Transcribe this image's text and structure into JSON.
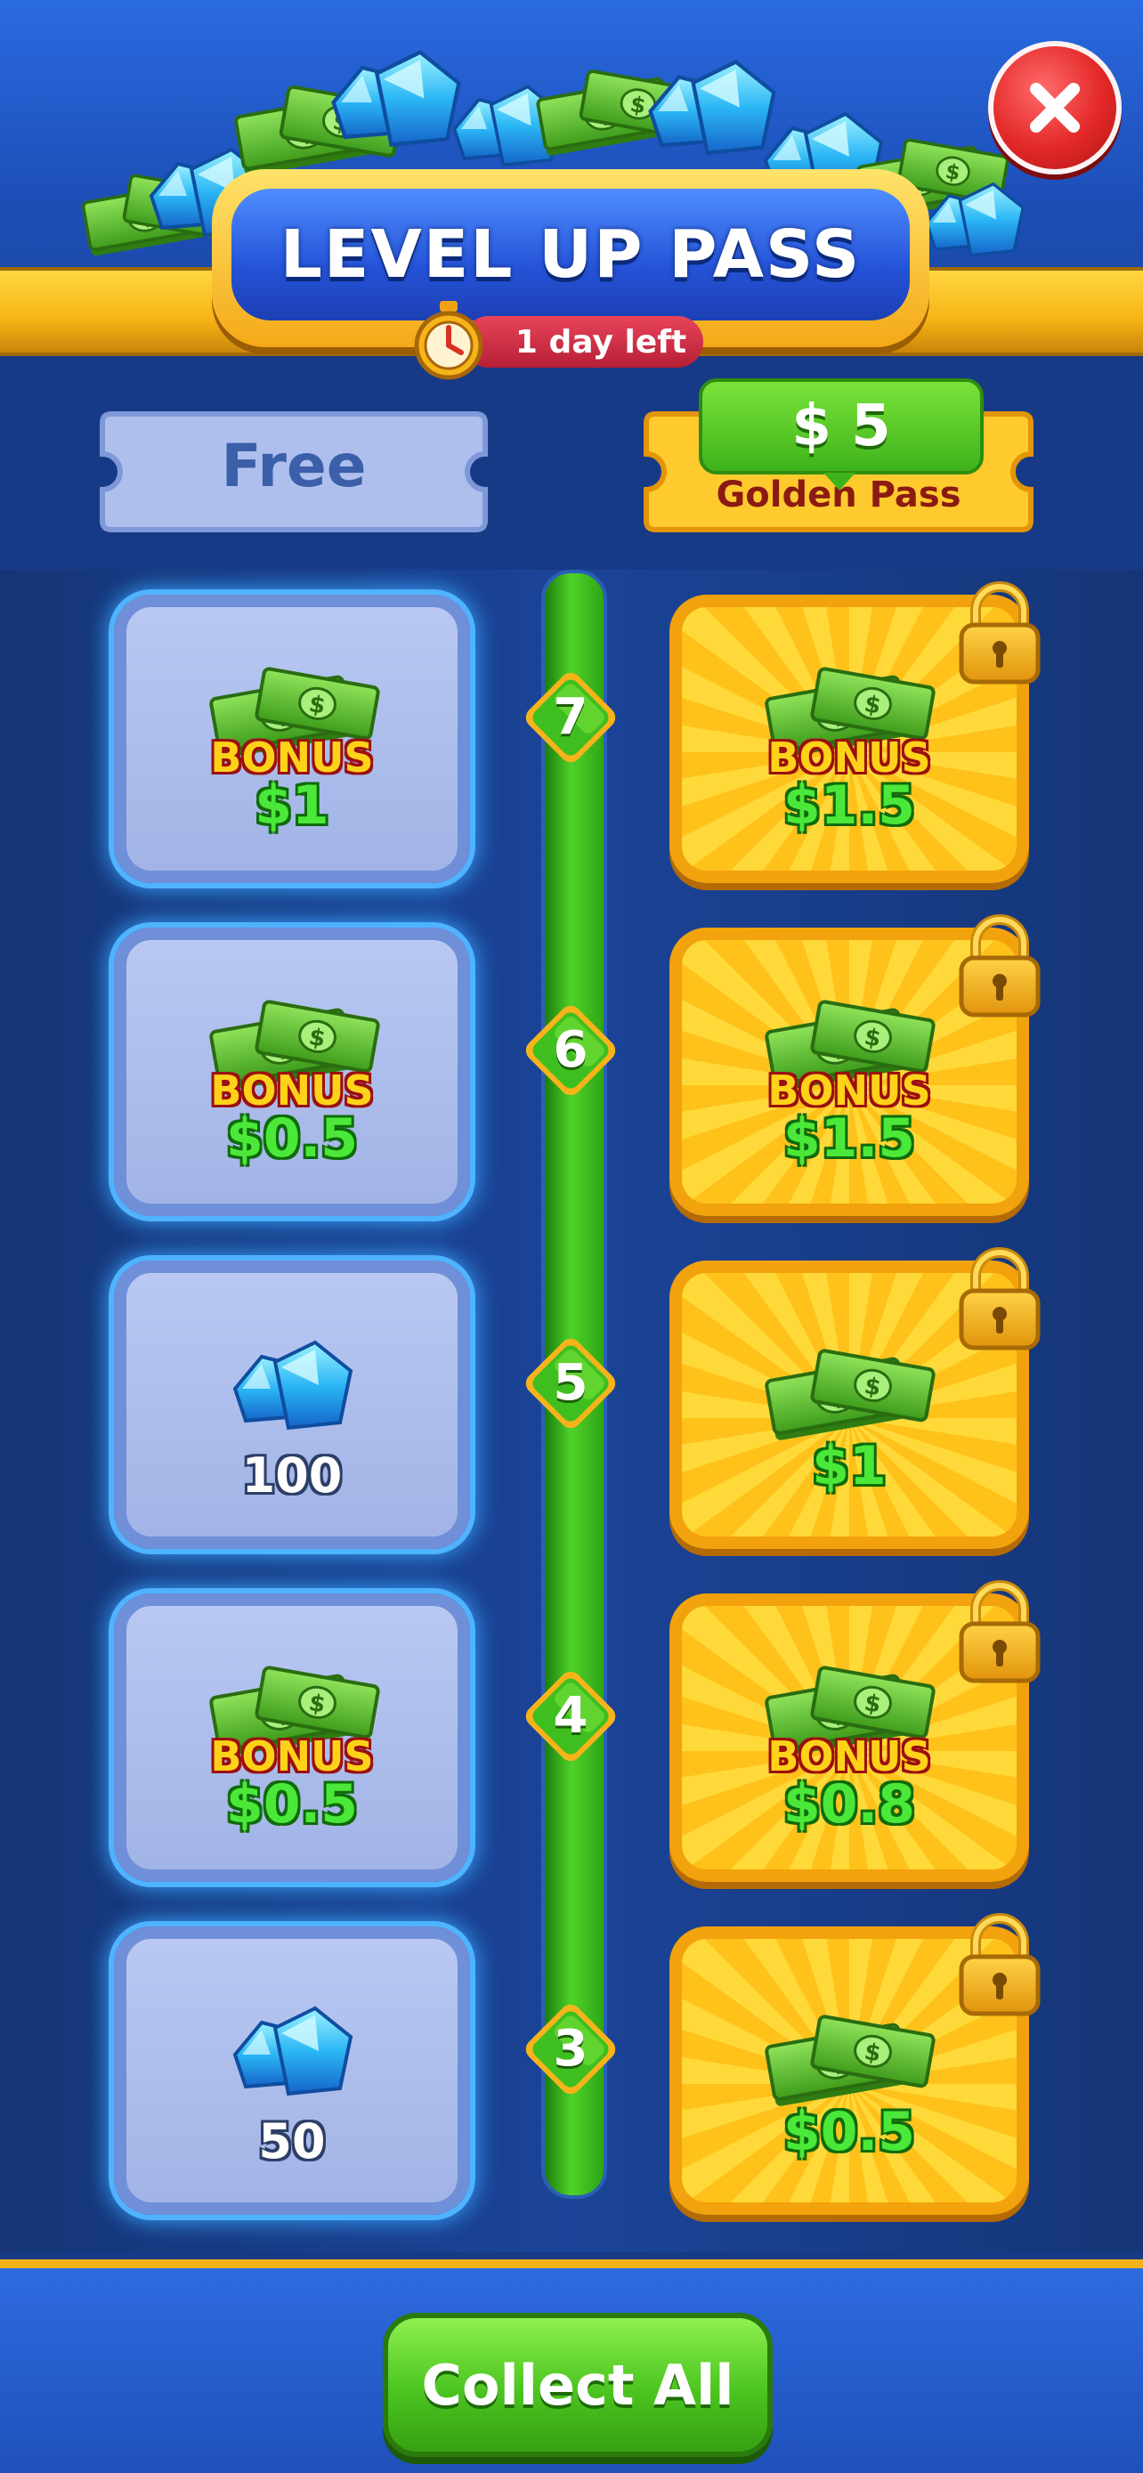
{
  "header": {
    "title": "LEVEL UP PASS",
    "timer": "1 day left",
    "close_icon": "close-x-icon"
  },
  "tracks": {
    "free": {
      "label": "Free"
    },
    "golden": {
      "price": "$ 5",
      "label": "Golden Pass"
    }
  },
  "colors": {
    "free_card": "#a2b4e6",
    "golden_card": "#ffc21a",
    "track_green": "#4fd22a",
    "cash_text": "#4be83a",
    "bonus_text": "#ffd21a"
  },
  "levels": [
    {
      "level": "7",
      "free": {
        "icon": "cash-bundle-icon",
        "bonus": "BONUS",
        "amount": "$1"
      },
      "golden": {
        "icon": "cash-bundle-icon",
        "bonus": "BONUS",
        "amount": "$1.5",
        "locked": true
      }
    },
    {
      "level": "6",
      "free": {
        "icon": "cash-bundle-icon",
        "bonus": "BONUS",
        "amount": "$0.5"
      },
      "golden": {
        "icon": "cash-bundle-icon",
        "bonus": "BONUS",
        "amount": "$1.5",
        "locked": true
      }
    },
    {
      "level": "5",
      "free": {
        "icon": "gem-icon",
        "amount": "100"
      },
      "golden": {
        "icon": "cash-bundle-icon",
        "amount": "$1",
        "locked": true
      }
    },
    {
      "level": "4",
      "free": {
        "icon": "cash-bundle-icon",
        "bonus": "BONUS",
        "amount": "$0.5"
      },
      "golden": {
        "icon": "cash-bundle-icon",
        "bonus": "BONUS",
        "amount": "$0.8",
        "locked": true
      }
    },
    {
      "level": "3",
      "free": {
        "icon": "gem-icon",
        "amount": "50"
      },
      "golden": {
        "icon": "cash-bundle-icon",
        "amount": "$0.5",
        "locked": true
      }
    }
  ],
  "footer": {
    "collect_label": "Collect All"
  }
}
